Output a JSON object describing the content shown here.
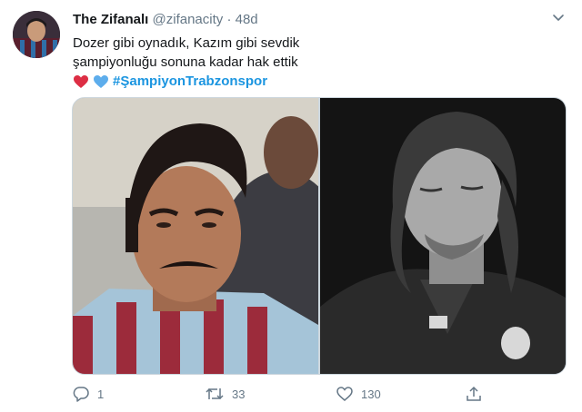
{
  "tweet": {
    "author_name": "The Zifanalı",
    "handle": "@zifanacity",
    "separator": "·",
    "time": "48d",
    "text_line1": "Dozer gibi oynadık, Kazım gibi sevdik",
    "text_line2": "şampiyonluğu sonuna kadar hak ettik",
    "hashtag": "#ŞampiyonTrabzonspor",
    "emojis": [
      "red-heart",
      "blue-heart"
    ]
  },
  "media": {
    "photos": [
      "vintage-player-striped-jersey",
      "bw-player-long-hair"
    ]
  },
  "actions": {
    "reply_count": "1",
    "retweet_count": "33",
    "like_count": "130"
  },
  "colors": {
    "link": "#1b95e0",
    "muted": "#657786",
    "heart_red": "#dd2e44",
    "heart_blue": "#5dadec"
  }
}
